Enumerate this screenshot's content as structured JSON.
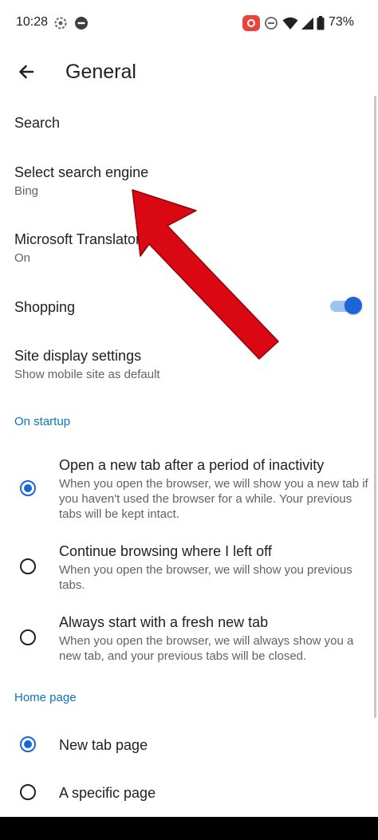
{
  "status_bar": {
    "time": "10:28",
    "battery_percent": "73%",
    "icons": [
      "gear-icon",
      "minus-circle-icon",
      "screen-record-icon",
      "do-not-disturb-icon",
      "wifi-icon",
      "signal-icon",
      "battery-icon"
    ]
  },
  "header": {
    "title": "General",
    "back_icon": "arrow-left-icon"
  },
  "settings": {
    "search_label": "Search",
    "search_engine": {
      "title": "Select search engine",
      "value": "Bing"
    },
    "translator": {
      "title": "Microsoft Translator",
      "value": "On"
    },
    "shopping": {
      "title": "Shopping",
      "enabled": true
    },
    "site_display": {
      "title": "Site display settings",
      "value": "Show mobile site as default"
    }
  },
  "on_startup": {
    "header": "On startup",
    "options": [
      {
        "title": "Open a new tab after a period of inactivity",
        "description": "When you open the browser, we will show you a new tab if you haven't used the browser for a while. Your previous tabs will be kept intact.",
        "selected": true
      },
      {
        "title": "Continue browsing where I left off",
        "description": "When you open the browser, we will show you previous tabs.",
        "selected": false
      },
      {
        "title": "Always start with a fresh new tab",
        "description": "When you open the browser, we will always show you a new tab, and your previous tabs will be closed.",
        "selected": false
      }
    ]
  },
  "home_page": {
    "header": "Home page",
    "options": [
      {
        "title": "New tab page",
        "selected": true
      },
      {
        "title": "A specific page",
        "selected": false
      }
    ]
  },
  "colors": {
    "accent": "#1a66d8",
    "section_header": "#0b74c4",
    "annotation_arrow": "#d90812"
  }
}
